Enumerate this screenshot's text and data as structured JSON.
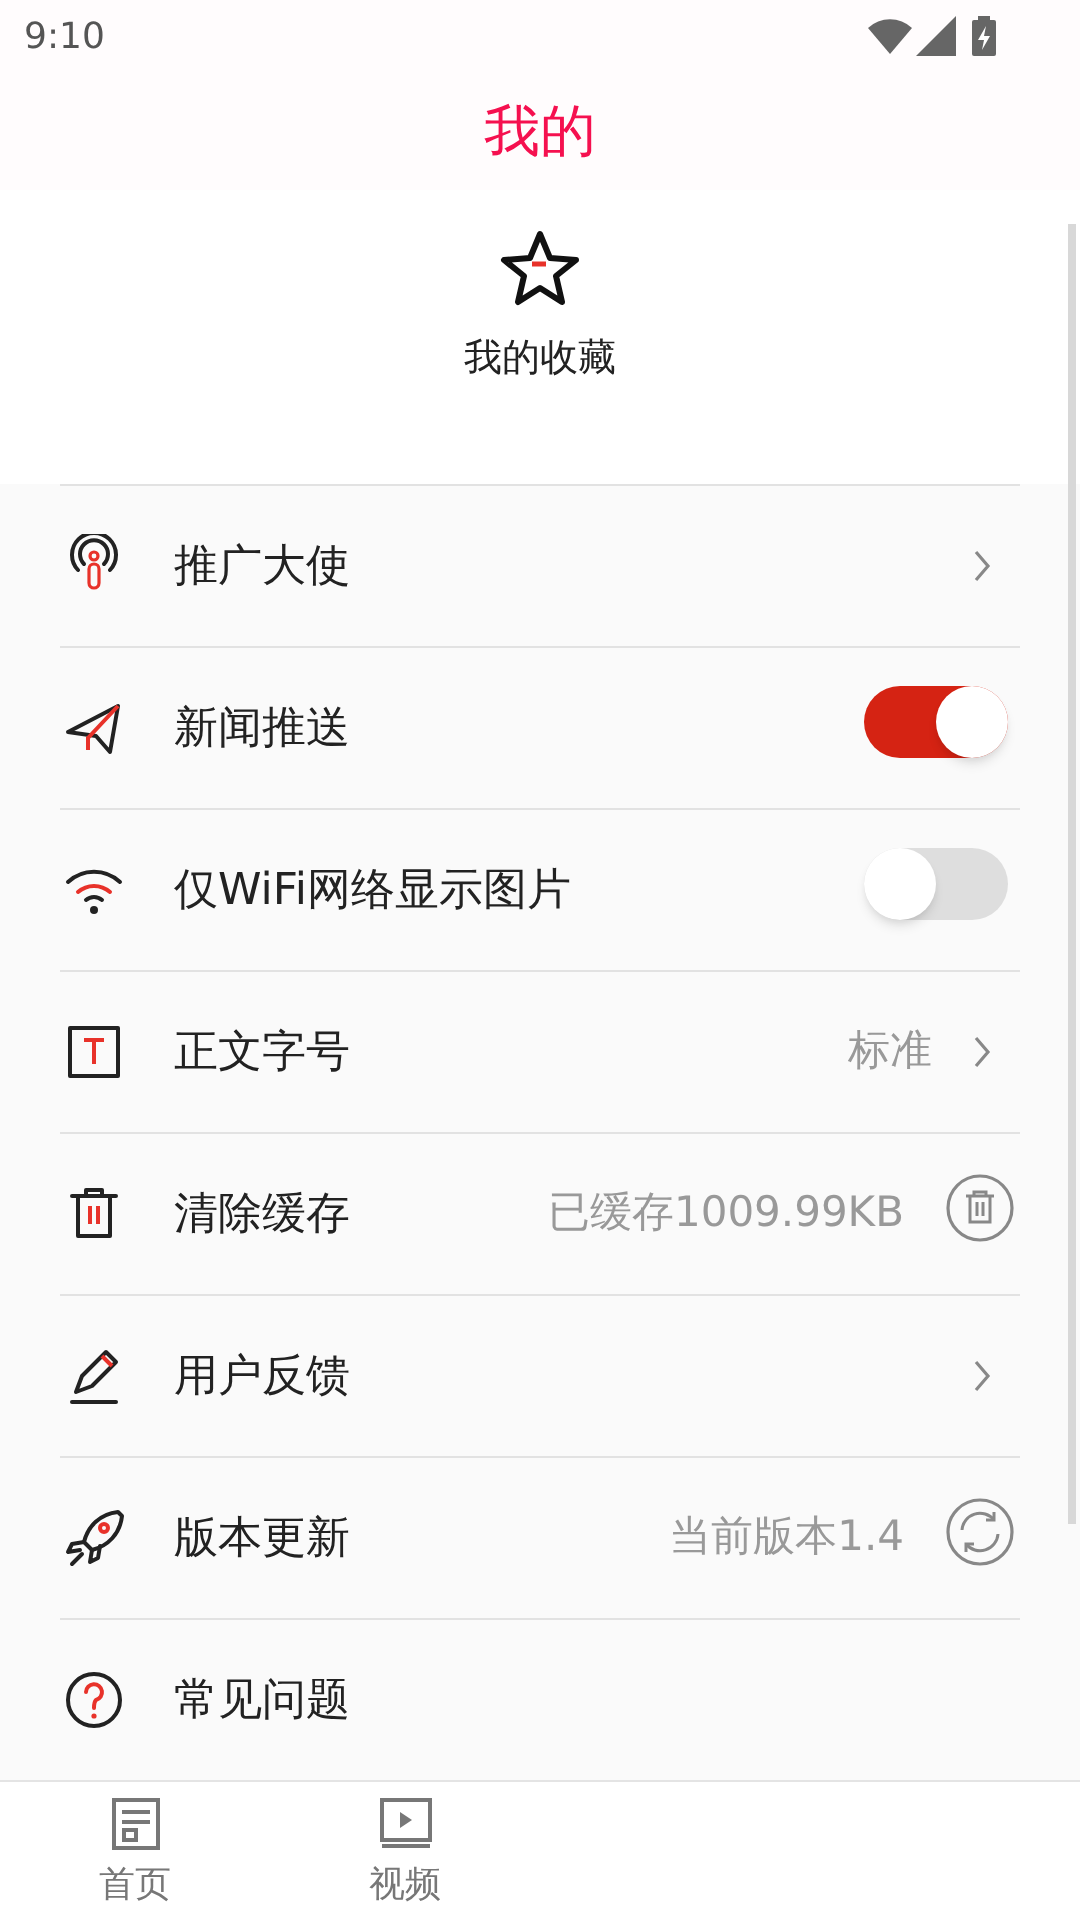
{
  "status_bar": {
    "time": "9:10"
  },
  "header": {
    "title": "我的"
  },
  "favorites": {
    "label": "我的收藏"
  },
  "settings": [
    {
      "kind": "link",
      "label": "推广大使"
    },
    {
      "kind": "toggle",
      "label": "新闻推送",
      "on": true
    },
    {
      "kind": "toggle",
      "label": "仅WiFi网络显示图片",
      "on": false
    },
    {
      "kind": "link",
      "label": "正文字号",
      "value": "标准"
    },
    {
      "kind": "clear",
      "label": "清除缓存",
      "value": "已缓存1009.99KB"
    },
    {
      "kind": "link",
      "label": "用户反馈"
    },
    {
      "kind": "refresh",
      "label": "版本更新",
      "value": "当前版本1.4"
    },
    {
      "kind": "plain",
      "label": "常见问题"
    }
  ],
  "bottom_nav": [
    {
      "label": "首页",
      "selected": false
    },
    {
      "label": "视频",
      "selected": false
    }
  ]
}
